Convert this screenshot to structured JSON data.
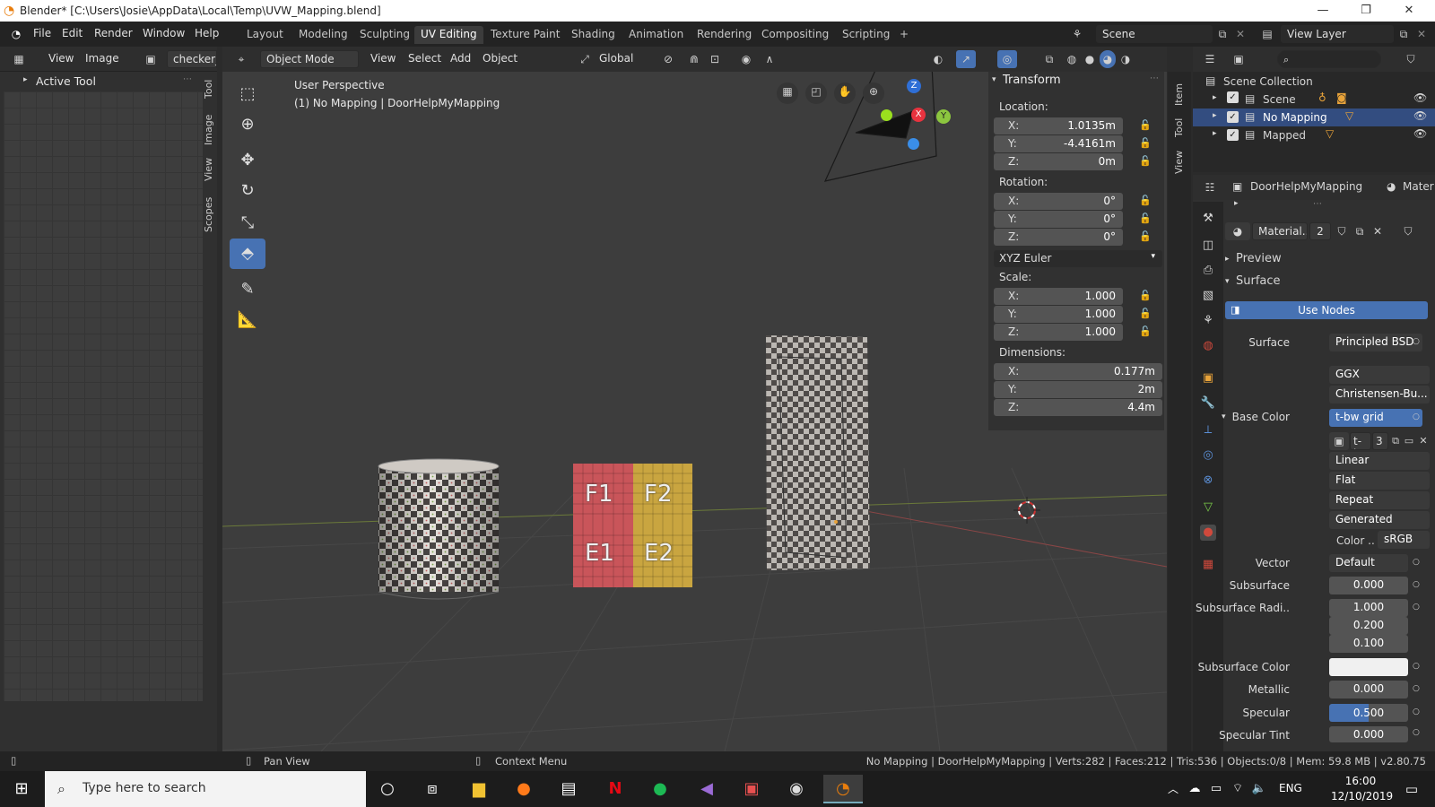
{
  "window": {
    "title": "Blender* [C:\\Users\\Josie\\AppData\\Local\\Temp\\UVW_Mapping.blend]",
    "minimize": "—",
    "maximize": "❐",
    "close": "✕"
  },
  "menus": [
    "File",
    "Edit",
    "Render",
    "Window",
    "Help"
  ],
  "workspaces": [
    "Layout",
    "Modeling",
    "Sculpting",
    "UV Editing",
    "Texture Paint",
    "Shading",
    "Animation",
    "Rendering",
    "Compositing",
    "Scripting",
    "+"
  ],
  "scene_name": "Scene",
  "view_layer": "View Layer",
  "uv_editor": {
    "view": "View",
    "image": "Image",
    "image_name": "checker_i",
    "active_tool": "Active Tool",
    "tabs": [
      "Tool",
      "Image",
      "View",
      "Scopes"
    ]
  },
  "viewport": {
    "mode": "Object Mode",
    "menus": [
      "View",
      "Select",
      "Add",
      "Object"
    ],
    "orientation": "Global",
    "info_line1": "User Perspective",
    "info_line2": "(1) No Mapping | DoorHelpMyMapping",
    "gizmo": {
      "x": "X",
      "y": "Y",
      "z": "Z"
    },
    "faces": {
      "f1": "F1",
      "f2": "F2",
      "e1": "E1",
      "e2": "E2"
    }
  },
  "npanel": {
    "tabs": [
      "Item",
      "Tool",
      "View"
    ],
    "transform_title": "Transform",
    "location_label": "Location:",
    "location": [
      {
        "k": "X:",
        "v": "1.0135m"
      },
      {
        "k": "Y:",
        "v": "-4.4161m"
      },
      {
        "k": "Z:",
        "v": "0m"
      }
    ],
    "rotation_label": "Rotation:",
    "rotation": [
      {
        "k": "X:",
        "v": "0°"
      },
      {
        "k": "Y:",
        "v": "0°"
      },
      {
        "k": "Z:",
        "v": "0°"
      }
    ],
    "rotation_mode": "XYZ Euler",
    "scale_label": "Scale:",
    "scale": [
      {
        "k": "X:",
        "v": "1.000"
      },
      {
        "k": "Y:",
        "v": "1.000"
      },
      {
        "k": "Z:",
        "v": "1.000"
      }
    ],
    "dimensions_label": "Dimensions:",
    "dimensions": [
      {
        "k": "X:",
        "v": "0.177m"
      },
      {
        "k": "Y:",
        "v": "2m"
      },
      {
        "k": "Z:",
        "v": "4.4m"
      }
    ]
  },
  "outliner": {
    "collection": "Scene Collection",
    "items": [
      {
        "name": "Scene"
      },
      {
        "name": "No Mapping",
        "selected": true
      },
      {
        "name": "Mapped"
      }
    ]
  },
  "properties": {
    "object_name": "DoorHelpMyMapping",
    "tab_right": "Mater",
    "material_name": "Material...",
    "material_users": "2",
    "preview": "Preview",
    "surface_section": "Surface",
    "use_nodes": "Use Nodes",
    "surface_label": "Surface",
    "surface_value": "Principled BSD",
    "distribution": "GGX",
    "subsurface_method": "Christensen-Bu...",
    "base_color_label": "Base Color",
    "base_color_value": "t-bw grid",
    "image_short": "t-b",
    "image_users": "3",
    "interpolation": "Linear",
    "projection": "Flat",
    "extension": "Repeat",
    "source": "Generated",
    "color_label": "Color ..",
    "color_space": "sRGB",
    "vector_label": "Vector",
    "vector_value": "Default",
    "subsurface_label": "Subsurface",
    "subsurface_value": "0.000",
    "subsurface_radius_label": "Subsurface Radi..",
    "subsurface_radius": [
      "1.000",
      "0.200",
      "0.100"
    ],
    "subsurface_color_label": "Subsurface Color",
    "metallic_label": "Metallic",
    "metallic_value": "0.000",
    "specular_label": "Specular",
    "specular_value": "0.500",
    "specular_fraction": 0.5,
    "specular_tint_label": "Specular Tint",
    "specular_tint_value": "0.000"
  },
  "status": {
    "pan": "Pan View",
    "context": "Context Menu",
    "info": "No Mapping | DoorHelpMyMapping | Verts:282 | Faces:212 | Tris:536 | Objects:0/8 | Mem: 59.8 MB | v2.80.75"
  },
  "taskbar": {
    "search_placeholder": "Type here to search",
    "lang": "ENG",
    "time": "16:00",
    "date": "12/10/2019"
  },
  "colors": {
    "accent": "#4772b3",
    "face_red": "#c9555a",
    "face_yellow": "#c9a540"
  }
}
